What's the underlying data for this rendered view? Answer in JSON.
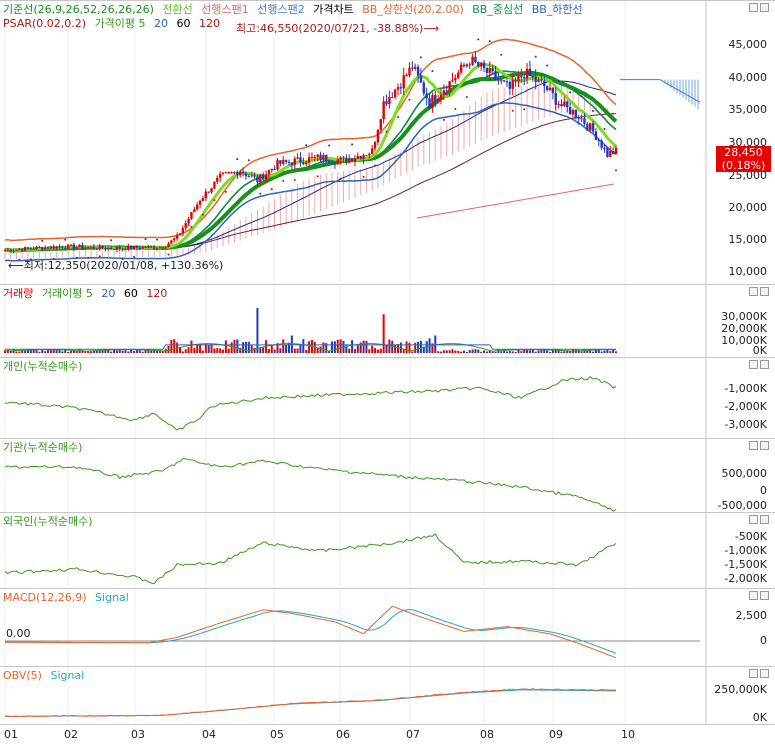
{
  "colors": {
    "candle_up": "#e60000",
    "candle_down": "#1f38c4",
    "kijun": "#1a8f1a",
    "tenkan": "#7ddc1f",
    "span1": "#e86464",
    "span2": "#3a7fd6",
    "bb_upper": "#e8642a",
    "bb_mid": "#0f8f4a",
    "bb_lower": "#2a62c8",
    "psar": "#2030a0",
    "volume_up": "#e60000",
    "volume_down": "#1f38c4",
    "investor_line": "#3a9a1a",
    "macd": "#e8642a",
    "signal": "#2aa4c8"
  },
  "main": {
    "legend1": [
      {
        "label": "기준선(26,9,26,52,26,26,26)",
        "color": "#1a8f1a"
      },
      {
        "label": "전환선",
        "color": "#7ddc1f"
      },
      {
        "label": "선행스팬1",
        "color": "#e86464"
      },
      {
        "label": "선행스팬2",
        "color": "#3a7fd6"
      },
      {
        "label": "가격차트",
        "color": "#000000"
      },
      {
        "label": "BB_상한선(20,2.00)",
        "color": "#e8642a"
      },
      {
        "label": "BB_중심선",
        "color": "#0f8f4a"
      },
      {
        "label": "BB_하한선",
        "color": "#2a62c8"
      }
    ],
    "legend2": [
      {
        "label": "PSAR(0.02,0.2)",
        "color": "#b01818"
      },
      {
        "label": "가격이평 5",
        "color": "#3a9a1a"
      },
      {
        "label": "20",
        "color": "#2a62c8"
      },
      {
        "label": "60",
        "color": "#000000"
      },
      {
        "label": "120",
        "color": "#b01818"
      }
    ],
    "high_annotation": "최고:46,550(2020/07/21, -38.88%)⟶",
    "low_annotation": "⟵최저:12,350(2020/01/08, +130.36%)",
    "current_price": "28,450",
    "current_change": "(0.18%)",
    "y_ticks": [
      "45,000",
      "40,000",
      "35,000",
      "30,000",
      "25,000",
      "20,000",
      "15,000",
      "10,000"
    ]
  },
  "volume": {
    "legend": [
      {
        "label": "거래량",
        "color": "#e60000"
      },
      {
        "label": "거래이평 5",
        "color": "#3a9a1a"
      },
      {
        "label": "20",
        "color": "#2a62c8"
      },
      {
        "label": "60",
        "color": "#000000"
      },
      {
        "label": "120",
        "color": "#b01818"
      }
    ],
    "y_ticks": [
      "30,000K",
      "20,000K",
      "10,000K",
      "0K"
    ]
  },
  "individual": {
    "legend": "개인(누적순매수)",
    "y_ticks": [
      "-1,000K",
      "-2,000K",
      "-3,000K"
    ]
  },
  "institution": {
    "legend": "기관(누적순매수)",
    "y_ticks": [
      "500,000",
      "0",
      "-500,000"
    ]
  },
  "foreign": {
    "legend": "외국인(누적순매수)",
    "y_ticks": [
      "-500K",
      "-1,000K",
      "-1,500K",
      "-2,000K"
    ]
  },
  "macd": {
    "legend": [
      {
        "label": "MACD(12,26,9)",
        "color": "#e8642a"
      },
      {
        "label": "Signal",
        "color": "#2aa4c8"
      }
    ],
    "y_ticks": [
      "2,500",
      "0"
    ],
    "zero_label": "0.00"
  },
  "obv": {
    "legend": [
      {
        "label": "OBV(5)",
        "color": "#e8642a"
      },
      {
        "label": "Signal",
        "color": "#2aa4c8"
      }
    ],
    "y_ticks": [
      "250,000K",
      "0K"
    ]
  },
  "x_ticks": [
    "01",
    "02",
    "03",
    "04",
    "05",
    "06",
    "07",
    "08",
    "09",
    "10"
  ],
  "chart_data": [
    {
      "type": "line",
      "title": "",
      "series": [
        {
          "name": "가격이평 5",
          "values": [
            13200,
            13600,
            13400,
            13900,
            14500,
            15200,
            24500,
            27000,
            26500,
            38000,
            37000,
            39000,
            40000,
            38500,
            35000,
            28000,
            27500
          ]
        }
      ],
      "x": [
        "01",
        "02",
        "03",
        "04",
        "05",
        "06",
        "07",
        "08",
        "09",
        "10"
      ],
      "ylim": [
        10000,
        47000
      ],
      "annotations": [
        "최고:46,550(2020/07/21, -38.88%)",
        "최저:12,350(2020/01/08, +130.36%)"
      ],
      "last_price": 28450,
      "change_pct": 0.18
    },
    {
      "type": "bar",
      "title": "거래량",
      "ylim": [
        0,
        40000
      ],
      "unit": "K"
    },
    {
      "type": "line",
      "title": "개인(누적순매수)",
      "unit": "K",
      "ylim": [
        -3500,
        0
      ]
    },
    {
      "type": "line",
      "title": "기관(누적순매수)",
      "ylim": [
        -600000,
        800000
      ]
    },
    {
      "type": "line",
      "title": "외국인(누적순매수)",
      "unit": "K",
      "ylim": [
        -2200,
        -200
      ]
    },
    {
      "type": "line",
      "title": "MACD(12,26,9)",
      "series": [
        {
          "name": "MACD"
        },
        {
          "name": "Signal"
        }
      ],
      "ylim": [
        -1500,
        4000
      ]
    },
    {
      "type": "line",
      "title": "OBV(5)",
      "series": [
        {
          "name": "OBV"
        },
        {
          "name": "Signal"
        }
      ],
      "ylim": [
        0,
        400000
      ],
      "unit": "K"
    }
  ]
}
